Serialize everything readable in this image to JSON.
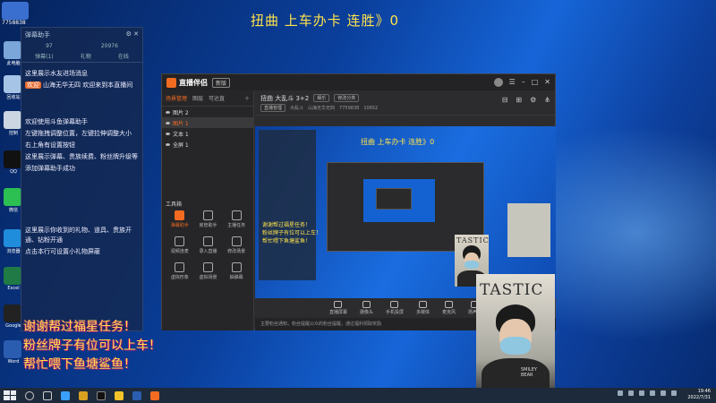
{
  "screen": {
    "top_banner": "扭曲  上车办卡 连胜》0",
    "top_left_number": "7758838"
  },
  "chat_panel": {
    "title": "弹幕助手",
    "stats": [
      "97",
      "20976"
    ],
    "tabs": [
      "弹幕(1)",
      "礼物",
      "在线"
    ],
    "messages": [
      {
        "tag": "",
        "text": "这里展示水友进场消息"
      },
      {
        "tag": "欢迎",
        "text": "山海无华无四 欢迎来到本直播间"
      },
      {
        "tag": "",
        "text": "欢迎使用斗鱼弹幕助手"
      },
      {
        "tag": "",
        "text": "左键拖拽调整位置，左键拉伸调整大小"
      },
      {
        "tag": "",
        "text": "右上角有设置按钮"
      },
      {
        "tag": "",
        "text": "这里展示弹幕、贵族续费、粉丝牌升级等"
      },
      {
        "tag": "",
        "text": "添加弹幕助手成功"
      },
      {
        "tag": "",
        "text": "这里展示你收到的礼物、道具、贵族开通、钻粉开通"
      },
      {
        "tag": "",
        "text": "点击本行可设置小礼物屏蔽"
      }
    ]
  },
  "desktop_icons": [
    "此电脑",
    "回收站",
    "控制",
    "QQ",
    "微信",
    "浏览器",
    "Excel",
    "Google",
    "Word"
  ],
  "app": {
    "name": "直播伴侣",
    "badge": "新版",
    "scene_tabs": [
      "场景管理",
      "图层",
      "可达直"
    ],
    "scene_items": [
      {
        "name": "图片 2",
        "selected": false
      },
      {
        "name": "图片 1",
        "selected": true
      },
      {
        "name": "文本 1",
        "selected": false
      },
      {
        "name": "全屏 1",
        "selected": false
      }
    ],
    "tools_title": "工具箱",
    "tools": [
      {
        "label": "弹幕助手",
        "hot": true
      },
      {
        "label": "房管助手",
        "hot": false
      },
      {
        "label": "主播任务",
        "hot": false
      },
      {
        "label": "视频连麦",
        "hot": false
      },
      {
        "label": "录入直播",
        "hot": false
      },
      {
        "label": "修改场景",
        "hot": false
      },
      {
        "label": "虚拟形象",
        "hot": false
      },
      {
        "label": "虚拟场景",
        "hot": false
      },
      {
        "label": "抽弹幕",
        "hot": false
      }
    ],
    "stream_title": "扭曲 大乱斗 3+2",
    "stream_tag": "娱乐",
    "stream_edit": "修改分类",
    "room_label": "直播管理",
    "room_type": "大乱斗",
    "streamer_name": "山海无华无四",
    "room_id": "7759838",
    "fans_count": "10652",
    "preview_title": "扭曲 上车办卡 连胜》0",
    "preview_lines": [
      "谢谢帮过福星任务！",
      "粉丝牌子有位可以上车！",
      "帮忙喂下鱼塘鲨鱼！"
    ],
    "bottom_buttons": [
      "直播屏幕",
      "摄像头",
      "手机投屏",
      "多媒体",
      "麦克风",
      "扬声器"
    ],
    "status_text": "主要粉丝通知，粉丝提醒公众的粉丝提醒，通过福利领取奖励"
  },
  "overlay_text": [
    "谢谢帮过福星任务！",
    "粉丝牌子有位可以上车！",
    "帮忙喂下鱼塘鲨鱼！"
  ],
  "camera": {
    "small_text": "TASTIC",
    "big_text": "TASTIC",
    "shirt_text": "SMILEY BEAR"
  },
  "taskbar": {
    "time": "19:46",
    "date": "2022/7/31"
  }
}
